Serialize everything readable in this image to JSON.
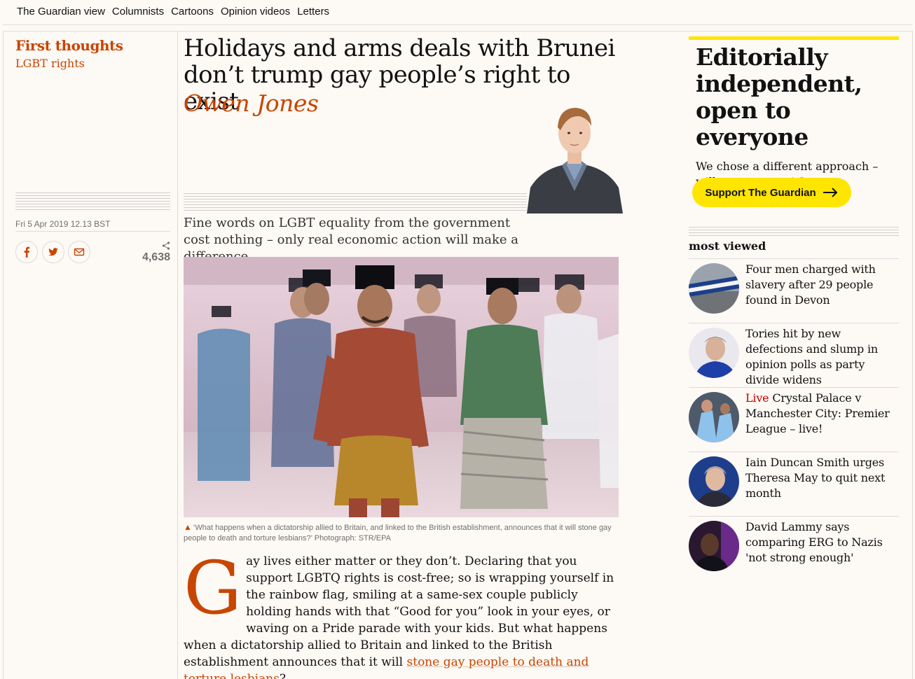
{
  "nav": {
    "items": [
      "The Guardian view",
      "Columnists",
      "Cartoons",
      "Opinion videos",
      "Letters"
    ]
  },
  "kicker": {
    "series": "First thoughts",
    "tag": "LGBT rights"
  },
  "article": {
    "headline": "Holidays and arms deals with Brunei don’t trump gay people’s right to exist",
    "byline": "Owen Jones",
    "dateline": "Fri 5 Apr 2019 12.13 BST",
    "share_count": "4,638",
    "standfirst": "Fine words on LGBT equality from the government cost nothing – only real economic action will make a difference",
    "caption": "‘What happens when a dictatorship allied to Britain, and linked to the British establishment, announces that it will stone gay people to death and torture lesbians?’ Photograph: STR/EPA",
    "dropcap": "G",
    "body_start": "ay lives either matter or they don’t. Declaring that you support LGBTQ rights is cost-free; so is wrapping yourself in the rainbow flag, smiling at a same-sex couple publicly holding hands with that “Good for you” look in your eyes, or waving on a Pride parade with your kids. But what happens when a dictatorship allied to Britain and linked to the British establishment announces that it will ",
    "body_link": "stone gay people to death and torture lesbians",
    "body_end": "?"
  },
  "support": {
    "heading": "Editorially independent, open to everyone",
    "text": "We chose a different approach – will you support it?",
    "button": "Support The Guardian"
  },
  "most_viewed": {
    "title": "most viewed",
    "items": [
      {
        "live": "",
        "text": "Four men charged with slavery after 29 people found in Devon"
      },
      {
        "live": "",
        "text": "Tories hit by new defections and slump in opinion polls as party divide widens"
      },
      {
        "live": "Live",
        "text": "Crystal Palace v Manchester City: Premier League – live!"
      },
      {
        "live": "",
        "text": "Iain Duncan Smith urges Theresa May to quit next month"
      },
      {
        "live": "",
        "text": "David Lammy says comparing ERG to Nazis 'not strong enough'"
      }
    ]
  },
  "colors": {
    "accent": "#c74600",
    "support_yellow": "#ffe500",
    "live_red": "#c70000"
  }
}
